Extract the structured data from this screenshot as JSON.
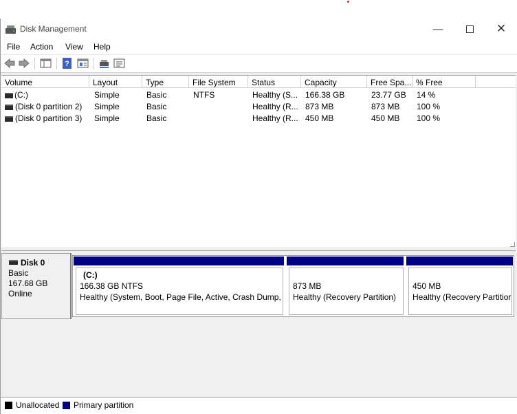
{
  "window": {
    "title": "Disk Management"
  },
  "menu": [
    "File",
    "Action",
    "View",
    "Help"
  ],
  "toolbar": [
    "back-arrow-icon",
    "forward-arrow-icon",
    "console-tree-icon",
    "help-icon",
    "properties-icon",
    "disk-icon",
    "list-view-icon"
  ],
  "volume_list": {
    "headers": [
      "Volume",
      "Layout",
      "Type",
      "File System",
      "Status",
      "Capacity",
      "Free Spa...",
      "% Free"
    ],
    "rows": [
      {
        "volume": " (C:)",
        "layout": "Simple",
        "type": "Basic",
        "fs": "NTFS",
        "status": "Healthy (S...",
        "capacity": "166.38 GB",
        "free": "23.77 GB",
        "pct": "14 %"
      },
      {
        "volume": "(Disk 0 partition 2)",
        "layout": "Simple",
        "type": "Basic",
        "fs": "",
        "status": "Healthy (R...",
        "capacity": "873 MB",
        "free": "873 MB",
        "pct": "100 %"
      },
      {
        "volume": "(Disk 0 partition 3)",
        "layout": "Simple",
        "type": "Basic",
        "fs": "",
        "status": "Healthy (R...",
        "capacity": "450 MB",
        "free": "450 MB",
        "pct": "100 %"
      }
    ]
  },
  "disk": {
    "name": "Disk 0",
    "type": "Basic",
    "size": "167.68 GB",
    "state": "Online"
  },
  "partitions": [
    {
      "name": "(C:)",
      "size": "166.38 GB NTFS",
      "status": "Healthy (System, Boot, Page File, Active, Crash Dump, P"
    },
    {
      "name": "",
      "size": "873 MB",
      "status": "Healthy (Recovery Partition)"
    },
    {
      "name": "",
      "size": "450 MB",
      "status": "Healthy (Recovery Partitior"
    }
  ],
  "legend": [
    {
      "label": "Unallocated",
      "color": "#000000"
    },
    {
      "label": "Primary partition",
      "color": "#00008b"
    }
  ],
  "colors": {
    "primary_partition": "#00008b",
    "unallocated": "#000000"
  }
}
